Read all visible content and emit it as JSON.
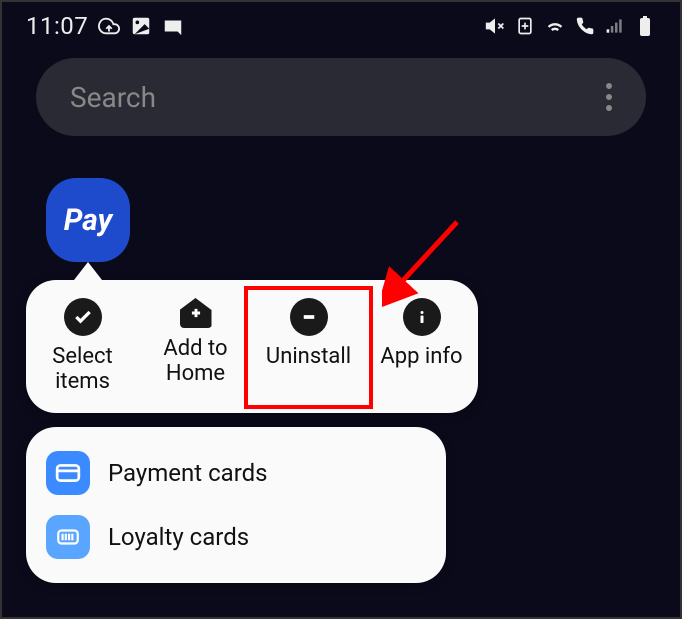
{
  "status": {
    "time": "11:07"
  },
  "search": {
    "placeholder": "Search"
  },
  "app": {
    "label": "Pay"
  },
  "menu": {
    "select": "Select items",
    "addHome": "Add to Home",
    "uninstall": "Uninstall",
    "appInfo": "App info"
  },
  "shortcuts": {
    "payment": "Payment cards",
    "loyalty": "Loyalty cards"
  }
}
